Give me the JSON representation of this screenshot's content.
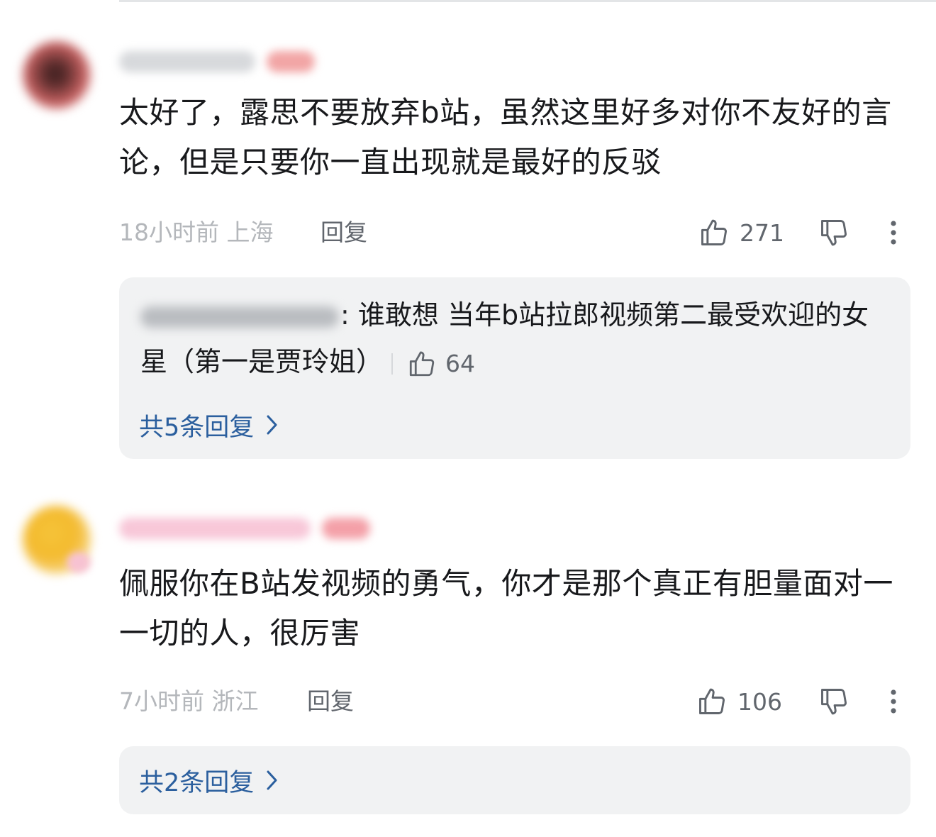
{
  "comments": [
    {
      "text": "太好了，露思不要放弃b站，虽然这里好多对你不友好的言论，但是只要你一直出现就是最好的反驳",
      "time": "18小时前",
      "location": "上海",
      "reply_label": "回复",
      "likes": "271",
      "sub_reply": {
        "text": ": 谁敢想 当年b站拉郎视频第二最受欢迎的女星（第一是贾玲姐）",
        "likes": "64"
      },
      "more_replies": "共5条回复"
    },
    {
      "text": "佩服你在B站发视频的勇气，你才是那个真正有胆量面对一一切的人，很厉害",
      "time": "7小时前",
      "location": "浙江",
      "reply_label": "回复",
      "likes": "106",
      "more_replies": "共2条回复"
    }
  ],
  "icons": {
    "like": "thumb-up-icon",
    "dislike": "thumb-down-icon",
    "more": "more-vertical-icon",
    "chevron": "chevron-right-icon"
  },
  "colors": {
    "link_blue": "#2b5f9e",
    "meta_gray": "#b4b7bb",
    "panel_bg": "#f1f2f3"
  }
}
